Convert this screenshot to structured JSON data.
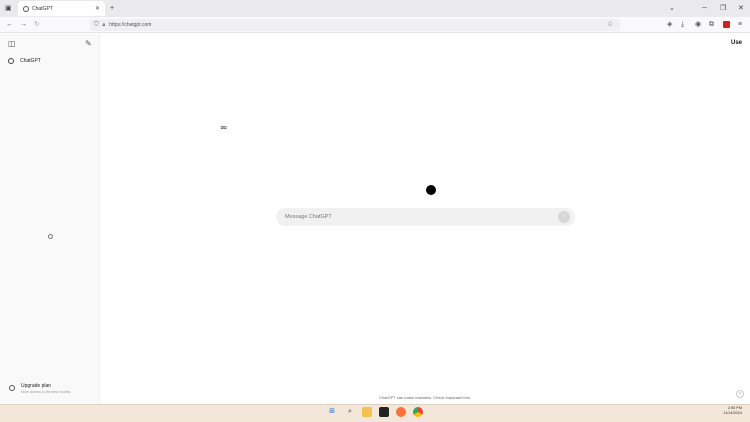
{
  "browser": {
    "tab_title": "ChatGPT",
    "tab_close": "✕",
    "new_tab": "+",
    "url": "https://chatgpt.com",
    "win_minimize": "─",
    "win_maximize": "❐",
    "win_close": "✕",
    "back": "←",
    "forward": "→",
    "reload": "↻",
    "star": "☆"
  },
  "sidebar": {
    "toggle_icon": "◫",
    "new_chat_icon": "✎",
    "items": [
      {
        "label": "ChatGPT"
      }
    ],
    "upgrade_title": "Upgrade plan",
    "upgrade_subtitle": "More access to the best models"
  },
  "main": {
    "user_label": "Use",
    "message_placeholder": "Message ChatGPT",
    "send_icon": "↑",
    "disclaimer": "ChatGPT can make mistakes. Check important info.",
    "help": "?"
  },
  "taskbar": {
    "time": "2:55 PM",
    "date": "11/14/2024"
  },
  "colors": {
    "taskbar_bg": "#f3e7d9",
    "sidebar_bg": "#f9f9f9",
    "input_bg": "#f1f1f1"
  }
}
